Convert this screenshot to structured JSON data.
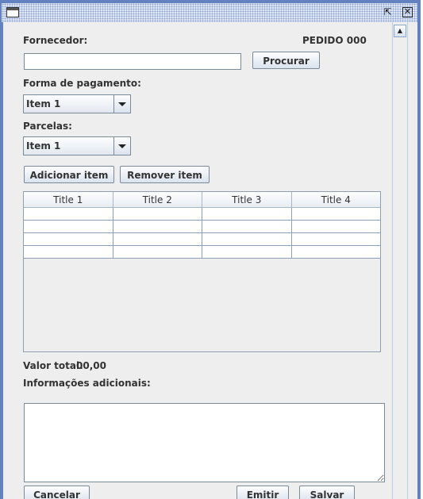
{
  "window": {
    "system_icon": "window-menu-icon",
    "maximize_icon": "maximize-icon",
    "close_icon": "close-icon"
  },
  "form": {
    "supplier_label": "Fornecedor:",
    "order_label": "PEDIDO 000",
    "supplier_value": "",
    "search_button": "Procurar",
    "payment_label": "Forma de pagamento:",
    "payment_selected": "Item 1",
    "installments_label": "Parcelas:",
    "installments_selected": "Item 1",
    "add_item_button": "Adicionar item",
    "remove_item_button": "Remover item",
    "total_label": "Valor total:",
    "total_value": "00,00",
    "notes_label": "Informações adicionais:",
    "notes_value": "",
    "cancel_button": "Cancelar",
    "emit_button": "Emitir",
    "save_button": "Salvar"
  },
  "table": {
    "columns": [
      "Title 1",
      "Title 2",
      "Title 3",
      "Title 4"
    ],
    "rows": [
      [
        "",
        "",
        "",
        ""
      ],
      [
        "",
        "",
        "",
        ""
      ],
      [
        "",
        "",
        "",
        ""
      ],
      [
        "",
        "",
        "",
        ""
      ]
    ]
  },
  "scrollbar": {
    "up_icon": "arrow-up-icon"
  }
}
